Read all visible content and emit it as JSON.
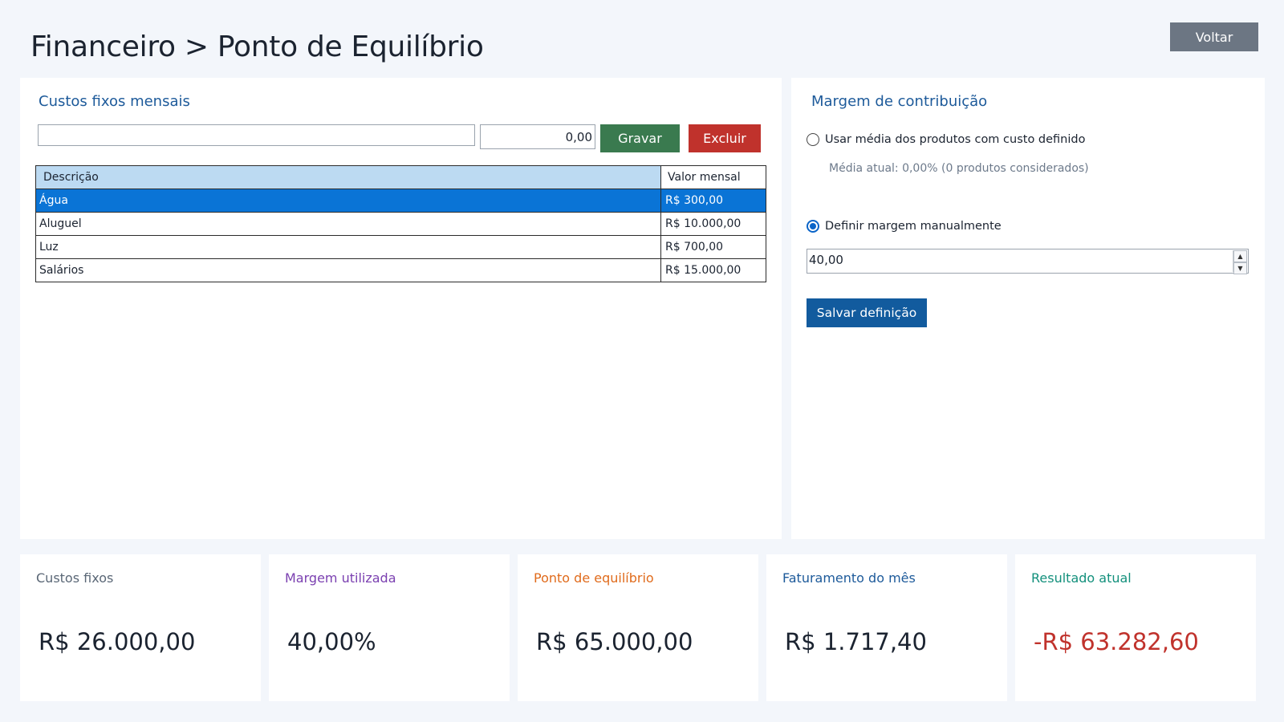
{
  "header": {
    "title": "Financeiro > Ponto de Equilíbrio",
    "back_label": "Voltar"
  },
  "fixed_costs": {
    "title": "Custos fixos mensais",
    "description_value": "",
    "amount_value": "0,00",
    "save_label": "Gravar",
    "delete_label": "Excluir",
    "columns": [
      "Descrição",
      "Valor mensal"
    ],
    "rows": [
      {
        "description": "Água",
        "value": "R$ 300,00",
        "selected": true
      },
      {
        "description": "Aluguel",
        "value": "R$ 10.000,00",
        "selected": false
      },
      {
        "description": "Luz",
        "value": "R$ 700,00",
        "selected": false
      },
      {
        "description": "Salários",
        "value": "R$ 15.000,00",
        "selected": false
      }
    ]
  },
  "margin": {
    "title": "Margem de contribuição",
    "option_average": "Usar média dos produtos com custo definido",
    "average_hint": "Média atual: 0,00% (0 produtos considerados)",
    "option_manual": "Definir margem manualmente",
    "selected_option": "manual",
    "manual_value": "40,00",
    "save_label": "Salvar definição"
  },
  "summary": {
    "fixed_costs": {
      "label": "Custos fixos",
      "value": "R$ 26.000,00",
      "label_color": "#5a6776",
      "value_color": "#1b2330"
    },
    "margin_used": {
      "label": "Margem utilizada",
      "value": "40,00%",
      "label_color": "#7a3fb0",
      "value_color": "#1b2330"
    },
    "break_even": {
      "label": "Ponto de equilíbrio",
      "value": "R$ 65.000,00",
      "label_color": "#e06b1c",
      "value_color": "#1b2330"
    },
    "revenue": {
      "label": "Faturamento do mês",
      "value": "R$ 1.717,40",
      "label_color": "#1d5a9a",
      "value_color": "#1b2330"
    },
    "result": {
      "label": "Resultado atual",
      "value": "-R$ 63.282,60",
      "label_color": "#13907c",
      "value_color": "#c0322c"
    }
  },
  "colors": {
    "background": "#f3f6fb",
    "accent_blue": "#125b9e",
    "save_green": "#3a7a4f",
    "delete_red": "#c0322c",
    "selection": "#0a74d6",
    "grid_header": "#bcdaf2"
  }
}
